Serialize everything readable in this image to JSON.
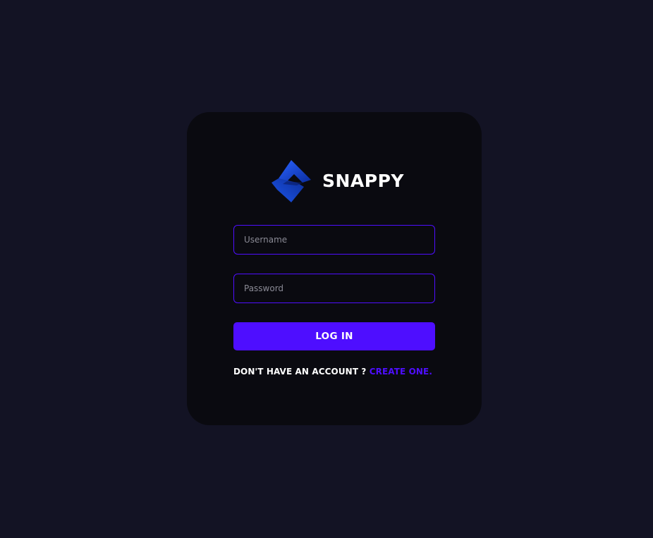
{
  "brand": {
    "name": "SNAPPY",
    "logo_icon": "snappy-logo-icon",
    "logo_colors": [
      "#0f3fd6",
      "#0a2c9e",
      "#1d5cf2"
    ]
  },
  "form": {
    "username_placeholder": "Username",
    "username_value": "",
    "password_placeholder": "Password",
    "password_value": "",
    "login_label": "LOG IN",
    "signup_prompt": "DON'T HAVE AN ACCOUNT ? ",
    "signup_link": "CREATE ONE."
  },
  "colors": {
    "page_background": "#131324",
    "card_background": "#0a0a10",
    "accent": "#4e0eff",
    "text": "#ffffff",
    "placeholder": "#8a8a95"
  }
}
